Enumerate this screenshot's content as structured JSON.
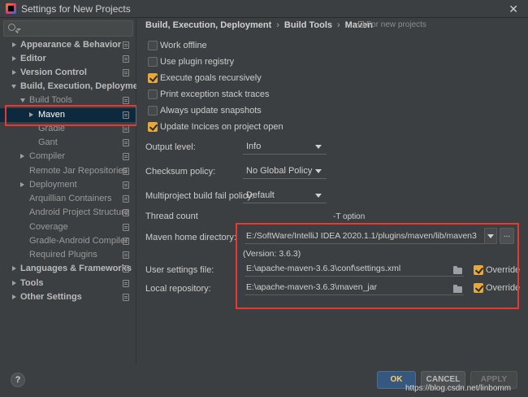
{
  "window": {
    "title": "Settings for New Projects",
    "close_glyph": "✕"
  },
  "search": {
    "placeholder": ""
  },
  "sidebar": {
    "items": [
      {
        "label": "Appearance & Behavior"
      },
      {
        "label": "Editor"
      },
      {
        "label": "Version Control"
      },
      {
        "label": "Build, Execution, Deployment"
      },
      {
        "label": "Build Tools"
      },
      {
        "label": "Maven"
      },
      {
        "label": "Gradle"
      },
      {
        "label": "Gant"
      },
      {
        "label": "Compiler"
      },
      {
        "label": "Remote Jar Repositories"
      },
      {
        "label": "Deployment"
      },
      {
        "label": "Arquillian Containers"
      },
      {
        "label": "Android Project Structure"
      },
      {
        "label": "Coverage"
      },
      {
        "label": "Gradle-Android Compiler"
      },
      {
        "label": "Required Plugins"
      },
      {
        "label": "Languages & Frameworks"
      },
      {
        "label": "Tools"
      },
      {
        "label": "Other Settings"
      }
    ]
  },
  "breadcrumb": {
    "items": [
      "Build, Execution, Deployment",
      "Build Tools",
      "Maven"
    ],
    "separator": "›",
    "scope": "For new projects"
  },
  "checkboxes": [
    {
      "label": "Work offline",
      "checked": false
    },
    {
      "label": "Use plugin registry",
      "checked": false
    },
    {
      "label": "Execute goals recursively",
      "checked": true
    },
    {
      "label": "Print exception stack traces",
      "checked": false
    },
    {
      "label": "Always update snapshots",
      "checked": false
    },
    {
      "label": "Update Incices on project open",
      "checked": true
    }
  ],
  "fields": {
    "output_level": {
      "label": "Output level:",
      "value": "Info"
    },
    "checksum_policy": {
      "label": "Checksum policy:",
      "value": "No Global Policy"
    },
    "fail_policy": {
      "label": "Multiproject build fail policy:",
      "value": "Default"
    },
    "thread_count": {
      "label": "Thread count",
      "hint": "-T option"
    },
    "maven_home": {
      "label": "Maven home directory:",
      "value": "E:/SoftWare/IntelliJ IDEA 2020.1.1/plugins/maven/lib/maven3",
      "browse_label": "...",
      "version": "(Version: 3.6.3)"
    },
    "user_settings": {
      "label": "User settings file:",
      "value": "E:\\apache-maven-3.6.3\\conf\\settings.xml",
      "override_label": "Override",
      "override": true
    },
    "local_repo": {
      "label": "Local repository:",
      "value": "E:\\apache-maven-3.6.3\\maven_jar",
      "override_label": "Override",
      "override": true
    }
  },
  "footer": {
    "help_label": "?",
    "ok_label": "OK",
    "cancel_label": "CANCEL",
    "apply_label": "APPLY",
    "watermark": "https://blog.csdn.net/linbomm"
  },
  "colors": {
    "highlight_box": "#e53935",
    "checkbox_checked": "#e6a93a",
    "ok_text": "#ffcc55"
  }
}
